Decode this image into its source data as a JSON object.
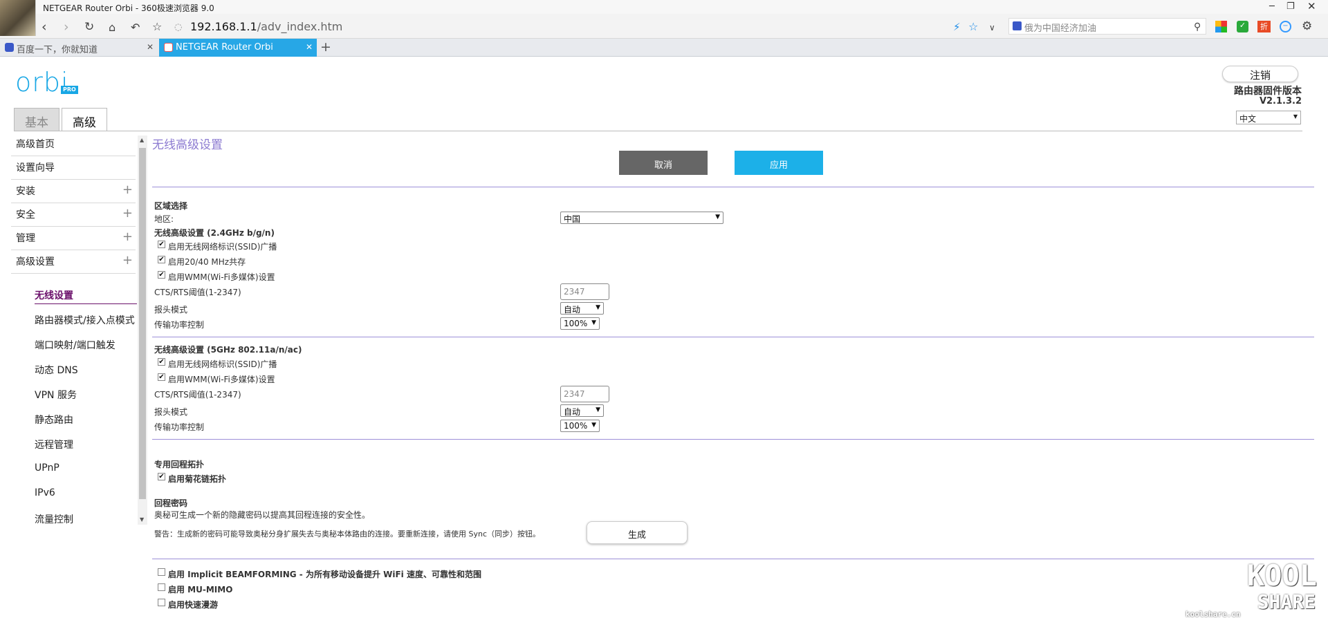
{
  "browser": {
    "window_title": "NETGEAR Router Orbi - 360极速浏览器 9.0",
    "url_host": "192.168.1.1",
    "url_path": "/adv_index.htm",
    "search_placeholder": "俄为中国经济加油",
    "tabs": [
      {
        "label": "百度一下，你就知道",
        "active": false
      },
      {
        "label": "NETGEAR Router Orbi",
        "active": true
      }
    ]
  },
  "header": {
    "logo_text": "orbi",
    "logo_badge": "PRO",
    "logout": "注销",
    "firmware_label": "路由器固件版本",
    "firmware_version": "V2.1.3.2",
    "language": "中文",
    "tabs": {
      "basic": "基本",
      "advanced": "高级"
    }
  },
  "sidebar": {
    "items": [
      {
        "label": "高级首页",
        "expandable": false
      },
      {
        "label": "设置向导",
        "expandable": false
      },
      {
        "label": "安装",
        "expandable": true
      },
      {
        "label": "安全",
        "expandable": true
      },
      {
        "label": "管理",
        "expandable": true
      },
      {
        "label": "高级设置",
        "expandable": true
      }
    ],
    "subitems": [
      {
        "label": "无线设置",
        "active": true
      },
      {
        "label": "路由器模式/接入点模式"
      },
      {
        "label": "端口映射/端口触发"
      },
      {
        "label": "动态 DNS"
      },
      {
        "label": "VPN 服务"
      },
      {
        "label": "静态路由"
      },
      {
        "label": "远程管理"
      },
      {
        "label": "UPnP"
      },
      {
        "label": "IPv6"
      },
      {
        "label": "流量控制"
      }
    ]
  },
  "main": {
    "title": "无线高级设置",
    "cancel": "取消",
    "apply": "应用",
    "region": {
      "heading": "区域选择",
      "label": "地区:",
      "value": "中国"
    },
    "band24": {
      "heading": "无线高级设置 (2.4GHz b/g/n)",
      "ssid_broadcast": "启用无线网络标识(SSID)广播",
      "coexist": "启用20/40 MHz共存",
      "wmm": "启用WMM(Wi-Fi多媒体)设置",
      "cts_label": "CTS/RTS阈值(1-2347)",
      "cts_value": "2347",
      "preamble_label": "报头模式",
      "preamble_value": "自动",
      "power_label": "传输功率控制",
      "power_value": "100%"
    },
    "band5": {
      "heading": "无线高级设置 (5GHz 802.11a/n/ac)",
      "ssid_broadcast": "启用无线网络标识(SSID)广播",
      "wmm": "启用WMM(Wi-Fi多媒体)设置",
      "cts_label": "CTS/RTS阈值(1-2347)",
      "cts_value": "2347",
      "preamble_label": "报头模式",
      "preamble_value": "自动",
      "power_label": "传输功率控制",
      "power_value": "100%"
    },
    "backhaul": {
      "heading": "专用回程拓扑",
      "daisy": "启用菊花链拓扑"
    },
    "backhaul_pw": {
      "heading": "回程密码",
      "desc": "奥秘可生成一个新的隐藏密码以提高其回程连接的安全性。",
      "warning": "警告：生成新的密码可能导致奥秘分身扩展失去与奥秘本体路由的连接。要重新连接，请使用 Sync（同步）按钮。",
      "generate": "生成"
    },
    "beamforming": "启用 Implicit BEAMFORMING - 为所有移动设备提升 WiFi 速度、可靠性和范围",
    "mumimo": "启用 MU-MIMO",
    "fast_roaming": "启用快速漫游"
  },
  "watermark": {
    "line1": "KOOL",
    "line2": "SHARE",
    "site": "koolshare.cn"
  },
  "colors": {
    "accent": "#1cb0e8",
    "title": "#8c7bd1",
    "separator": "#9c8fd8",
    "active_nav": "#6a0f6a"
  }
}
